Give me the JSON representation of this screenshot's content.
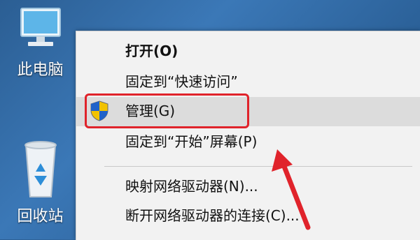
{
  "desktop": {
    "icons": [
      {
        "label": "此电脑",
        "icon": "computer-icon"
      },
      {
        "label": "回收站",
        "icon": "recycle-bin-icon"
      }
    ]
  },
  "context_menu": {
    "items": [
      {
        "label": "打开(O)",
        "bold": true
      },
      {
        "label": "固定到“快速访问”"
      },
      {
        "label": "管理(G)",
        "icon": "uac-shield-icon",
        "highlighted": true
      },
      {
        "label": "固定到“开始”屏幕(P)"
      },
      {
        "label": "映射网络驱动器(N)..."
      },
      {
        "label": "断开网络驱动器的连接(C)..."
      }
    ]
  },
  "colors": {
    "annotation_red": "#e0232b",
    "desktop_blue": "#2f6aa6",
    "menu_bg": "#f2f2f2"
  }
}
